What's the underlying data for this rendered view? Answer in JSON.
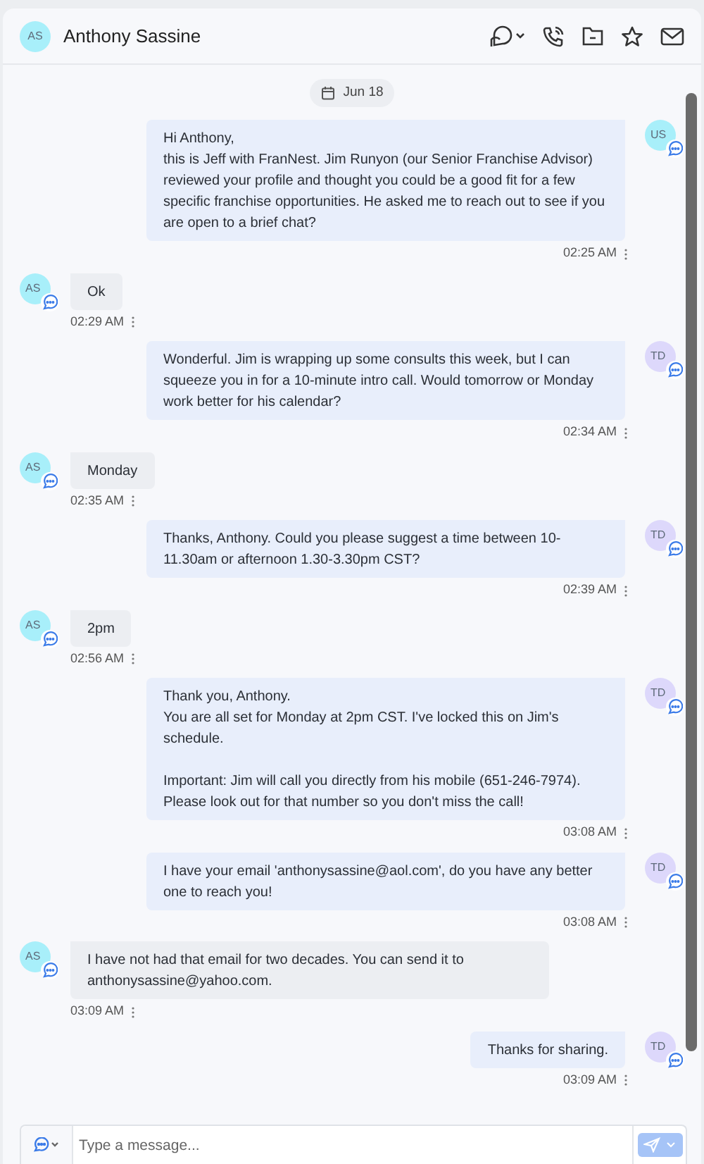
{
  "header": {
    "avatar": "AS",
    "name": "Anthony Sassine"
  },
  "date_chip": "Jun 18",
  "messages": [
    {
      "kind": "out",
      "avatar": "US",
      "color": "#a8effa",
      "text": "Hi Anthony,\nthis is Jeff with FranNest. Jim Runyon (our Senior Franchise Advisor) reviewed your profile and thought you could be a good fit for a few specific franchise opportunities. He asked me to reach out to see if you are open to a brief chat?",
      "time": "02:25 AM"
    },
    {
      "kind": "in",
      "avatar": "AS",
      "color": "#a8effa",
      "text": "Ok",
      "time": "02:29 AM"
    },
    {
      "kind": "out",
      "avatar": "TD",
      "color": "#ddd8fb",
      "text": "Wonderful. Jim is wrapping up some consults this week, but I can squeeze you in for a 10-minute intro call. Would tomorrow or Monday work better for his calendar?",
      "time": "02:34 AM"
    },
    {
      "kind": "in",
      "avatar": "AS",
      "color": "#a8effa",
      "text": "Monday",
      "time": "02:35 AM"
    },
    {
      "kind": "out",
      "avatar": "TD",
      "color": "#ddd8fb",
      "text": "Thanks, Anthony. Could you please suggest a time between 10-11.30am or afternoon 1.30-3.30pm CST?",
      "time": "02:39 AM"
    },
    {
      "kind": "in",
      "avatar": "AS",
      "color": "#a8effa",
      "text": "2pm",
      "time": "02:56 AM"
    },
    {
      "kind": "out",
      "avatar": "TD",
      "color": "#ddd8fb",
      "text": "Thank you, Anthony.\nYou are all set for Monday at 2pm CST. I've locked this on Jim's schedule.\n\nImportant: Jim will call you directly from his mobile (651-246-7974). Please look out for that number so you don't miss the call!",
      "time": "03:08 AM"
    },
    {
      "kind": "out",
      "avatar": "TD",
      "color": "#ddd8fb",
      "text": "I have your email 'anthonysassine@aol.com', do you have any better one to reach you!",
      "time": "03:08 AM"
    },
    {
      "kind": "in",
      "avatar": "AS",
      "color": "#a8effa",
      "text": "I have not had that email for two decades. You can send it to anthonysassine@yahoo.com.",
      "time": "03:09 AM"
    },
    {
      "kind": "out",
      "avatar": "TD",
      "color": "#ddd8fb",
      "text": "Thanks for sharing.",
      "time": "03:09 AM"
    }
  ],
  "composer": {
    "placeholder": "Type a message..."
  }
}
